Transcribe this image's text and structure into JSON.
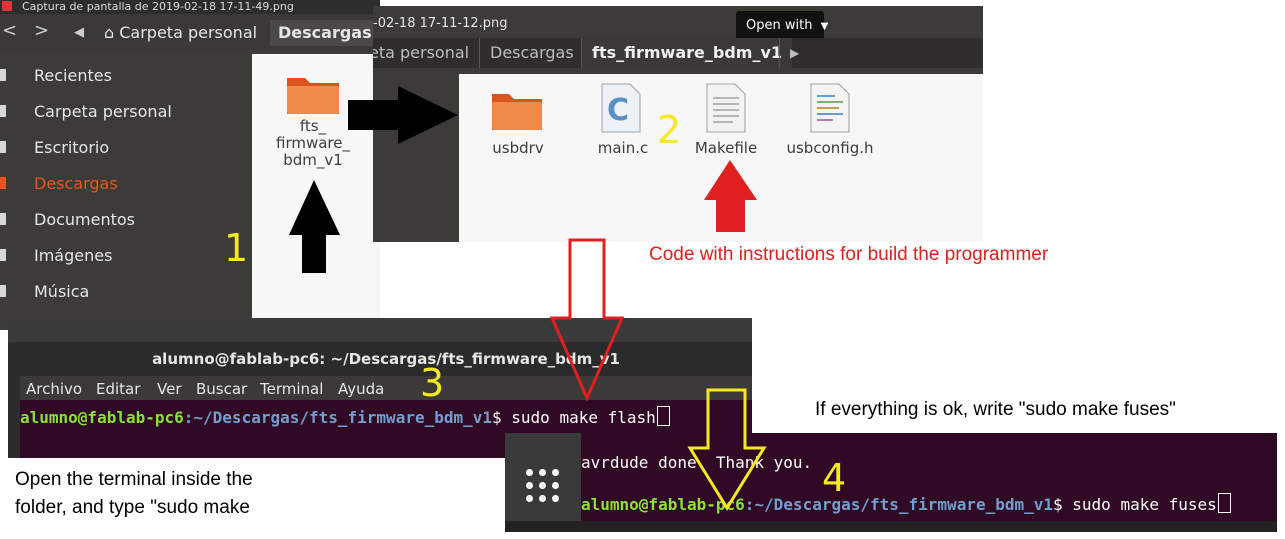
{
  "file_manager_1": {
    "window_title": "Captura de pantalla de 2019-02-18 17-11-49.png",
    "nav_back": "<",
    "nav_forward": ">",
    "breadcrumb_home": "Carpeta personal",
    "breadcrumb_current": "Descargas",
    "sidebar": [
      {
        "label": "Recientes"
      },
      {
        "label": "Carpeta personal"
      },
      {
        "label": "Escritorio"
      },
      {
        "label": "Descargas",
        "active": true
      },
      {
        "label": "Documentos"
      },
      {
        "label": "Imágenes"
      },
      {
        "label": "Música"
      }
    ],
    "folder_label": "fts_\nfirmware_\nbdm_v1"
  },
  "file_manager_2": {
    "window_title": "-02-18 17-11-12.png",
    "open_with": "Open with",
    "tabs": [
      "eta personal",
      "Descargas",
      "fts_firmware_bdm_v1"
    ],
    "files": [
      {
        "name": "usbdrv",
        "icon": "folder-icon"
      },
      {
        "name": "main.c",
        "icon": "c-source-icon"
      },
      {
        "name": "Makefile",
        "icon": "text-file-icon"
      },
      {
        "name": "usbconfig.h",
        "icon": "header-file-icon"
      }
    ]
  },
  "terminal_1": {
    "title": "alumno@fablab-pc6: ~/Descargas/fts_firmware_bdm_v1",
    "menu": [
      "Archivo",
      "Editar",
      "Ver",
      "Buscar",
      "Terminal",
      "Ayuda"
    ],
    "prompt_user": "alumno@fablab-pc6",
    "prompt_path": ":~/Descargas/fts_firmware_bdm_v1",
    "prompt_suffix": "$ sudo make flash"
  },
  "terminal_2": {
    "output_line": "avrdude done.  Thank you.",
    "prompt_user": "alumno@fablab-pc6",
    "prompt_path": ":~/Descargas/fts_firmware_bdm_v1",
    "prompt_suffix": "$ sudo make fuses"
  },
  "annotations": {
    "step1": "1",
    "step2": "2",
    "step3": "3",
    "step4": "4",
    "makefile_note": "Code with instructions for build the programmer",
    "fuses_note": "If everything is ok, write \"sudo make fuses\"",
    "terminal_note_line1": "Open the terminal inside the",
    "terminal_note_line2": "folder, and type \"sudo make"
  },
  "colors": {
    "ubuntu_orange": "#e95420",
    "terminal_bg": "#300a24",
    "annotation_yellow": "#f6ea1c",
    "annotation_red": "#e02020"
  }
}
